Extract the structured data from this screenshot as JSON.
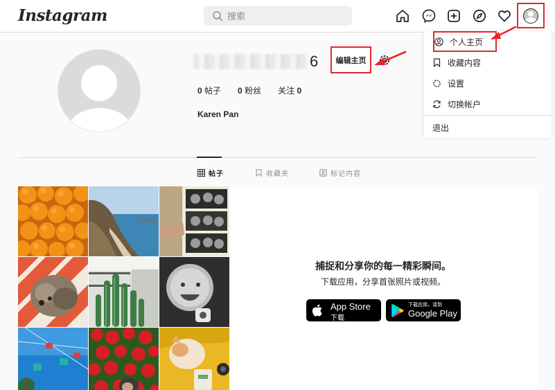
{
  "header": {
    "logo_text": "Instagram",
    "search_placeholder": "搜索",
    "nav_icons": [
      "home-icon",
      "messenger-icon",
      "new-post-icon",
      "explore-icon",
      "activity-icon",
      "profile-avatar-icon"
    ]
  },
  "profile": {
    "username_visible_suffix": "6",
    "edit_profile_label": "编辑主页",
    "stats": [
      {
        "count": "0",
        "label": "帖子"
      },
      {
        "count": "0",
        "label": "粉丝"
      },
      {
        "label": "关注",
        "count": "0"
      }
    ],
    "full_name": "Karen Pan"
  },
  "tabs": [
    {
      "label": "帖子",
      "icon": "grid-icon",
      "active": true
    },
    {
      "label": "收藏夹",
      "icon": "bookmark-icon",
      "active": false
    },
    {
      "label": "标记内容",
      "icon": "tagged-icon",
      "active": false
    }
  ],
  "empty_state": {
    "headline": "捕捉和分享你的每一精彩瞬间。",
    "subtext": "下载应用，分享首张照片或视频。",
    "app_store": {
      "line1": "App Store",
      "line2": "下载"
    },
    "google_play": {
      "line1": "下载应用，请到",
      "line2": "Google Play"
    }
  },
  "dropdown": {
    "items": [
      {
        "label": "个人主页",
        "icon": "profile-icon"
      },
      {
        "label": "收藏内容",
        "icon": "bookmark-icon"
      },
      {
        "label": "设置",
        "icon": "settings-icon"
      },
      {
        "label": "切换帐户",
        "icon": "switch-account-icon"
      }
    ],
    "logout_label": "退出"
  },
  "colors": {
    "highlight_border": "#e4272c",
    "text": "#262626",
    "muted": "#8e8e8e",
    "border": "#dbdbdb",
    "background": "#fafafa"
  }
}
